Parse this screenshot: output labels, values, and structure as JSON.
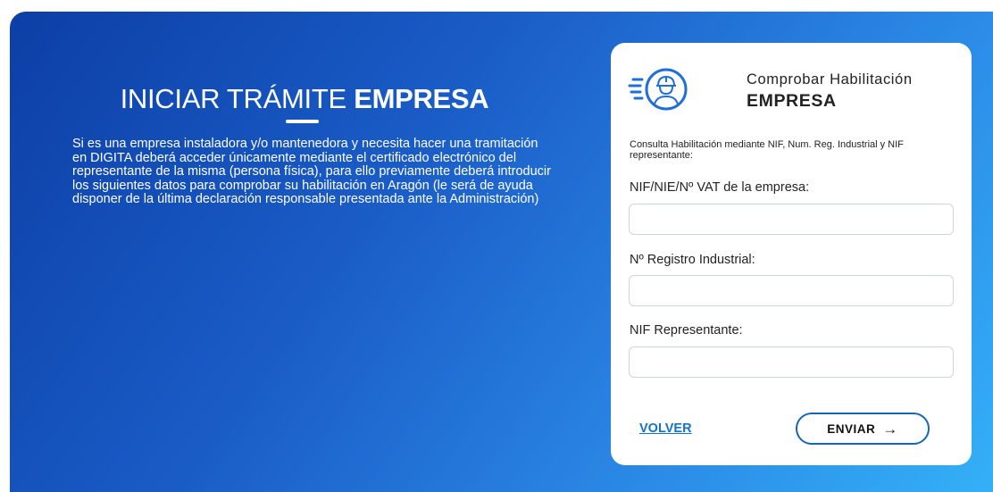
{
  "hero": {
    "title_pre": "INICIAR TRÁMITE",
    "title_strong": "EMPRESA",
    "description": "Si es una empresa instaladora y/o mantenedora y necesita hacer una tramitación en DIGITA deberá acceder únicamente mediante el certificado electrónico del representante de la misma (persona física), para ello previamente deberá introducir los siguientes datos para comprobar su habilitación en Aragón (le será de ayuda disponer de la última declaración responsable presentada ante la Administración)"
  },
  "card": {
    "title_line1": "Comprobar Habilitación",
    "title_line2": "EMPRESA",
    "icon": "worker-helmet-icon",
    "description": "Consulta Habilitación mediante NIF, Num. Reg. Industrial y NIF representante:",
    "fields": [
      {
        "label": "NIF/NIE/Nº VAT de la empresa:",
        "value": "",
        "placeholder": ""
      },
      {
        "label": "Nº Registro Industrial:",
        "value": "",
        "placeholder": ""
      },
      {
        "label": "NIF Representante:",
        "value": "",
        "placeholder": ""
      }
    ],
    "back_label": "VOLVER",
    "send_label": "ENVIAR",
    "send_icon": "arrow-right-icon"
  },
  "colors": {
    "gradient_start": "#0c3fa6",
    "gradient_end": "#34b0f7",
    "accent": "#1473c7",
    "card_bg": "#ffffff"
  }
}
